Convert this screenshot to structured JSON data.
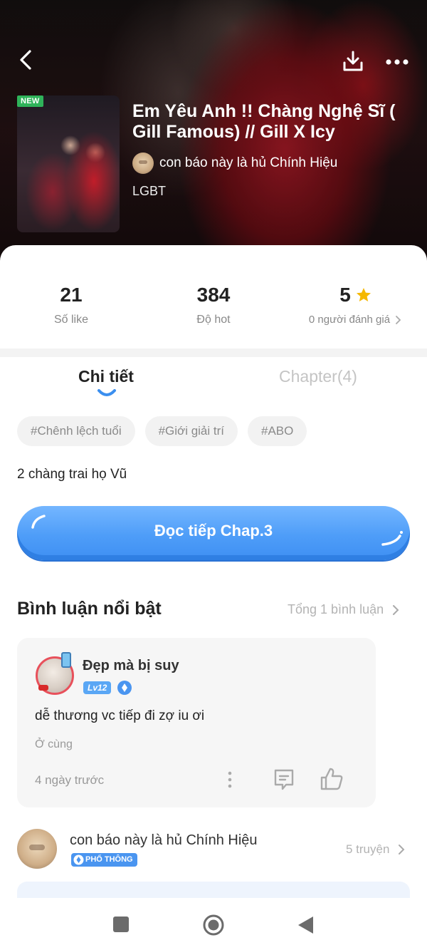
{
  "header": {
    "badge": "NEW",
    "title": "Em Yêu Anh !! Chàng Nghệ Sĩ ( Gill Famous) // Gill X Icy",
    "author": "con báo này là hủ Chính Hiệu",
    "genre": "LGBT"
  },
  "stats": {
    "likes": {
      "value": "21",
      "label": "Số like"
    },
    "hot": {
      "value": "384",
      "label": "Độ hot"
    },
    "rating": {
      "value": "5",
      "label": "0 người đánh giá"
    }
  },
  "tabs": [
    {
      "label": "Chi tiết",
      "active": true
    },
    {
      "label": "Chapter(4)",
      "active": false
    }
  ],
  "tags": [
    "#Chênh lệch tuổi",
    "#Giới giải trí",
    "#ABO"
  ],
  "description": "2 chàng trai họ Vũ",
  "cta": {
    "label": "Đọc tiếp Chap.3"
  },
  "comments": {
    "title": "Bình luận nổi bật",
    "total": "Tổng 1 bình luận",
    "items": [
      {
        "user": "Đẹp mà bị suy",
        "level": "Lv12",
        "text": "dễ thương vc tiếp đi zợ iu ơi",
        "subtext": "Ở cùng",
        "time": "4 ngày trước"
      }
    ]
  },
  "author_card": {
    "name": "con báo này là hủ Chính Hiệu",
    "badge": "PHỔ THÔNG",
    "stories": "5 truyện"
  },
  "icons": {
    "back": "back-arrow-icon",
    "download": "download-icon",
    "more": "more-horizontal-icon",
    "star": "star-icon",
    "gem": "gem-icon",
    "reply": "comment-icon",
    "like": "thumbs-up-icon"
  },
  "colors": {
    "accent": "#4e9df8",
    "star": "#f5b800",
    "new_badge": "#2fb35a",
    "tab_indicator": "#3b8fef"
  }
}
